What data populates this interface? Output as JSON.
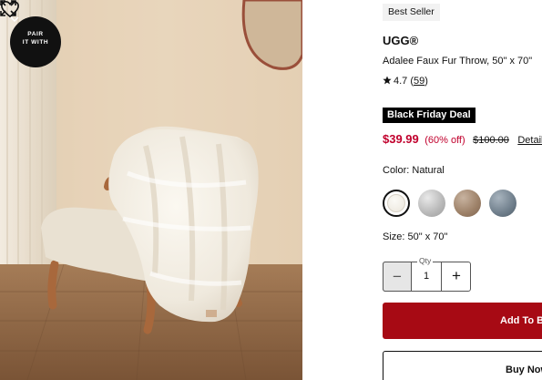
{
  "image": {
    "pair_badge": "PAIR\nIT WITH",
    "icons": [
      "chevron-down-icon",
      "heart-icon",
      "expand-icon"
    ]
  },
  "product": {
    "badge": "Best Seller",
    "brand": "UGG®",
    "name": "Adalee Faux Fur Throw, 50\" x 70\"",
    "rating": "4.7",
    "review_count": "59",
    "deal_label": "Black Friday Deal",
    "price": "$39.99",
    "discount": "(60% off)",
    "original_price": "$100.00",
    "details_link": "Details",
    "color_label": "Color: Natural",
    "colors": [
      "Natural",
      "Grey",
      "Brown",
      "Blue"
    ],
    "color_hex": [
      "#f3f0e8",
      "#bdbdbd",
      "#9c8067",
      "#6f7e8b"
    ],
    "size_label": "Size: 50\" x 70\"",
    "qty_label": "Qty",
    "qty_value": "1",
    "add_to_bag": "Add To Bag",
    "buy_now": "Buy Now",
    "accent_color": "#a70a14",
    "sale_color": "#c1002d"
  }
}
